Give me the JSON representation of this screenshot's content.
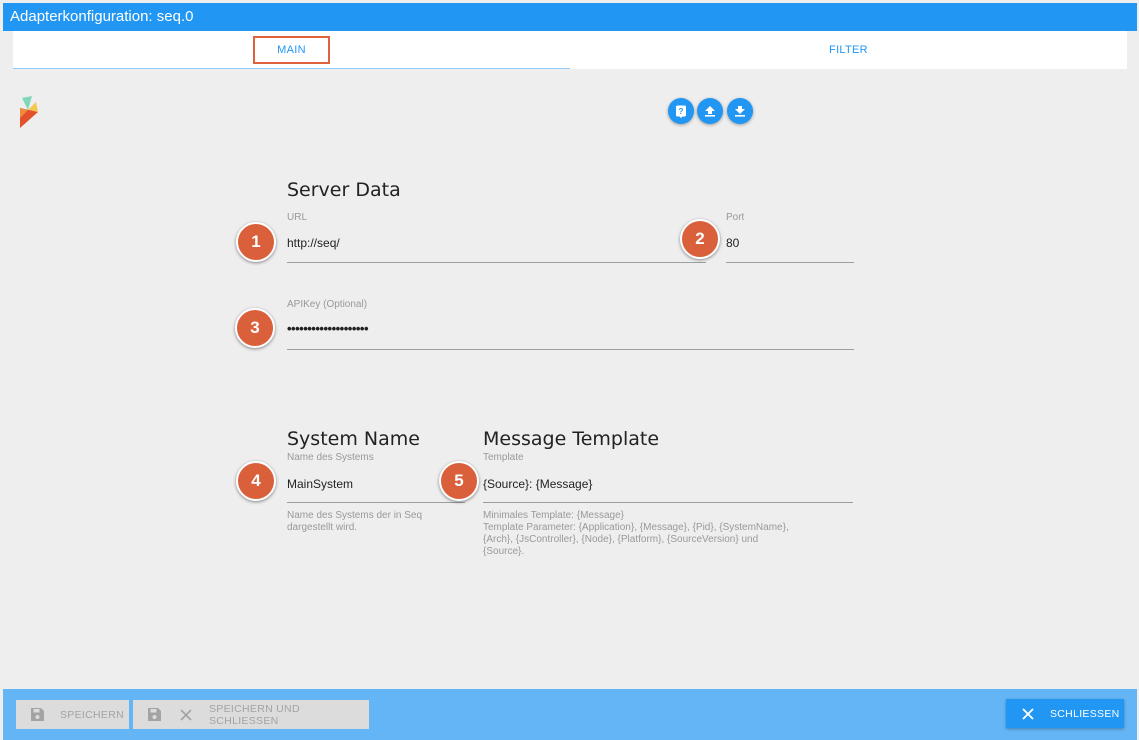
{
  "window": {
    "title": "Adapterkonfiguration: seq.0"
  },
  "tabs": {
    "main": "MAIN",
    "filter": "FILTER"
  },
  "toolbar": {
    "icons": [
      "help-icon",
      "upload-icon",
      "download-icon"
    ]
  },
  "server_data": {
    "title": "Server Data",
    "url": {
      "label": "URL",
      "value": "http://seq/"
    },
    "port": {
      "label": "Port",
      "value": "80"
    },
    "apikey": {
      "label": "APIKey (Optional)",
      "value": "••••••••••••••••••••"
    }
  },
  "system_name": {
    "title": "System Name",
    "label": "Name des Systems",
    "value": "MainSystem",
    "help_line1": "Name des Systems der in Seq",
    "help_line2": "dargestellt wird."
  },
  "message_template": {
    "title": "Message Template",
    "label": "Template",
    "value": "{Source}: {Message}",
    "help_line1": "Minimales Template: {Message}",
    "help_line2": "Template Parameter: {Application}, {Message}, {Pid}, {SystemName},",
    "help_line3": "{Arch}, {JsController}, {Node}, {Platform}, {SourceVersion} und",
    "help_line4": "{Source}."
  },
  "badges": [
    "1",
    "2",
    "3",
    "4",
    "5"
  ],
  "footer": {
    "save": "SPEICHERN",
    "save_close": "SPEICHERN UND SCHLIESSEN",
    "close": "SCHLIESSEN"
  },
  "colors": {
    "accent": "#2196f3",
    "footer": "#64b5f6",
    "badge": "#d9603b"
  }
}
